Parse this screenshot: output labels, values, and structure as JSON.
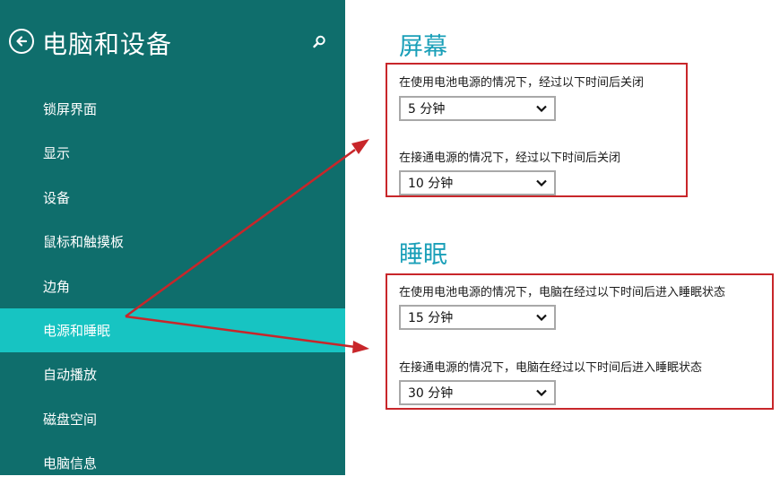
{
  "sidebar": {
    "title": "电脑和设备",
    "items": [
      {
        "label": "锁屏界面"
      },
      {
        "label": "显示"
      },
      {
        "label": "设备"
      },
      {
        "label": "鼠标和触摸板"
      },
      {
        "label": "边角"
      },
      {
        "label": "电源和睡眠",
        "active": true
      },
      {
        "label": "自动播放"
      },
      {
        "label": "磁盘空间"
      },
      {
        "label": "电脑信息"
      }
    ]
  },
  "main": {
    "screen": {
      "title": "屏幕",
      "battery_label": "在使用电池电源的情况下，经过以下时间后关闭",
      "battery_value": "5 分钟",
      "plugged_label": "在接通电源的情况下，经过以下时间后关闭",
      "plugged_value": "10 分钟"
    },
    "sleep": {
      "title": "睡眠",
      "battery_label": "在使用电池电源的情况下，电脑在经过以下时间后进入睡眠状态",
      "battery_value": "15 分钟",
      "plugged_label": "在接通电源的情况下，电脑在经过以下时间后进入睡眠状态",
      "plugged_value": "30 分钟"
    }
  },
  "icons": [
    "back-arrow-icon",
    "search-icon",
    "chevron-down-icon"
  ],
  "colors": {
    "sidebar_bg": "#0f6e6c",
    "active_item_bg": "#17c4c2",
    "section_title": "#1a9fb8",
    "annotation_red": "#c8262a"
  }
}
